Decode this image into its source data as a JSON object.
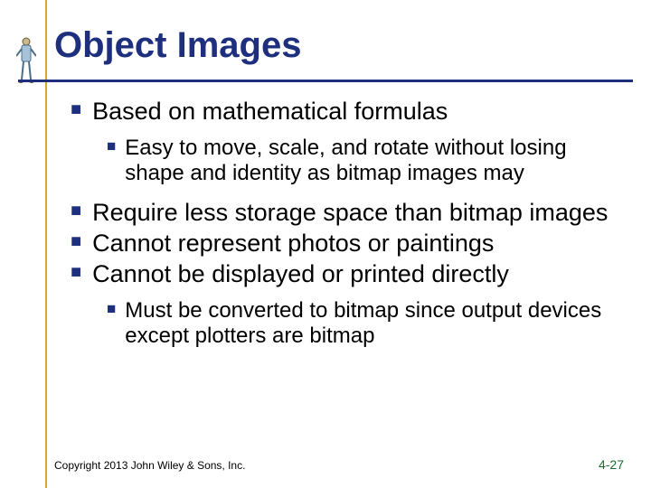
{
  "title": "Object Images",
  "bullets": {
    "b1": "Based on mathematical formulas",
    "b1a": "Easy to move, scale, and rotate without losing shape and identity as bitmap images may",
    "b2": "Require less storage space than bitmap images",
    "b3": "Cannot represent photos or paintings",
    "b4": "Cannot be displayed or printed directly",
    "b4a": "Must be converted to bitmap since output devices except plotters are bitmap"
  },
  "footer": {
    "copyright": "Copyright 2013 John Wiley & Sons, Inc.",
    "page": "4-27"
  }
}
